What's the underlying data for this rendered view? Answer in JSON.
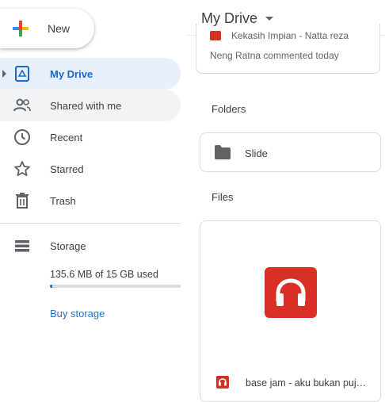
{
  "sidebar": {
    "new_label": "New",
    "items": [
      {
        "label": "My Drive",
        "icon": "my-drive-icon",
        "active": true
      },
      {
        "label": "Shared with me",
        "icon": "shared-icon"
      },
      {
        "label": "Recent",
        "icon": "clock-icon"
      },
      {
        "label": "Starred",
        "icon": "star-icon"
      },
      {
        "label": "Trash",
        "icon": "trash-icon"
      }
    ],
    "storage": {
      "label": "Storage",
      "used_text": "135.6 MB of 15 GB used",
      "used_fraction": 0.009,
      "buy_label": "Buy storage"
    }
  },
  "main": {
    "title": "My Drive",
    "activity": {
      "doc_title": "Kekasih Impian - Natta reza",
      "comment": "Neng Ratna commented today"
    },
    "folders_label": "Folders",
    "folders": [
      {
        "name": "Slide",
        "icon": "folder-icon"
      }
    ],
    "files_label": "Files",
    "files": [
      {
        "name": "base jam - aku bukan puj…",
        "icon": "audio-file-icon"
      }
    ]
  },
  "colors": {
    "accent": "#1a73e8",
    "active_bg": "#e8f0fe",
    "audio_red": "#d93025"
  }
}
